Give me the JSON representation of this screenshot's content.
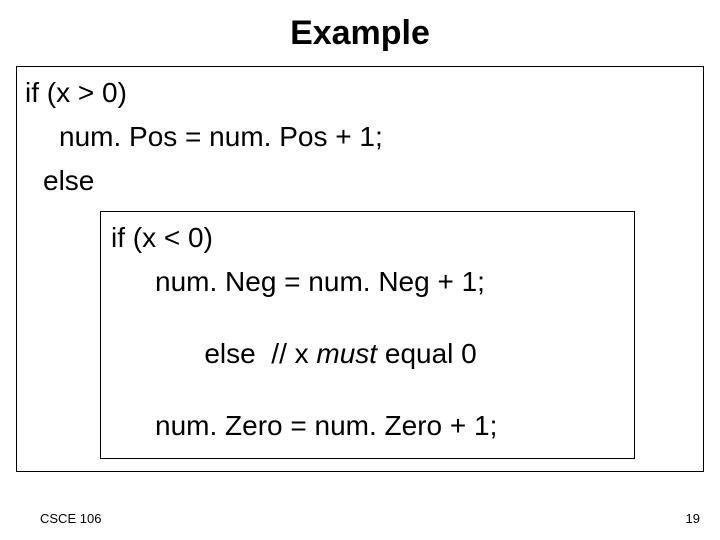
{
  "title": "Example",
  "outer": {
    "line1": "if (x > 0)",
    "line2": "num. Pos = num. Pos + 1;",
    "line3": "else"
  },
  "inner": {
    "line1": "if (x < 0)",
    "line2": "num. Neg = num. Neg + 1;",
    "line3_a": "else  // x ",
    "line3_b": "must",
    "line3_c": " equal 0",
    "line4": "num. Zero = num. Zero + 1;"
  },
  "footer": {
    "left": "CSCE 106",
    "right": "19"
  }
}
